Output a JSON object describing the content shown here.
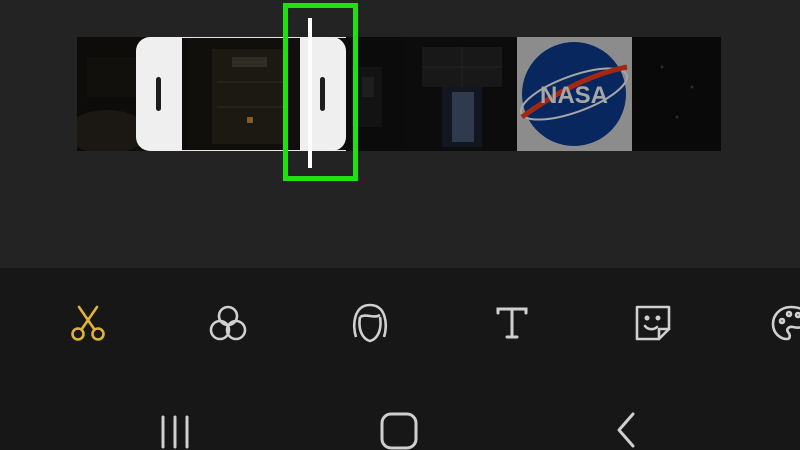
{
  "timeline": {
    "frames": [
      {
        "name": "frame-dark-room"
      },
      {
        "name": "frame-hangar-interior"
      },
      {
        "name": "frame-dark-corridor"
      },
      {
        "name": "frame-doorway-light"
      },
      {
        "name": "frame-nasa-logo",
        "logo_text": "NASA"
      },
      {
        "name": "frame-dark-end"
      }
    ]
  },
  "tools": [
    {
      "icon": "scissors-icon",
      "active": true
    },
    {
      "icon": "filter-circles-icon",
      "active": false
    },
    {
      "icon": "face-icon",
      "active": false
    },
    {
      "icon": "text-icon",
      "active": false
    },
    {
      "icon": "sticker-icon",
      "active": false
    },
    {
      "icon": "palette-icon",
      "active": false
    }
  ],
  "navbar": {
    "buttons": [
      {
        "icon": "recent-apps-icon"
      },
      {
        "icon": "home-icon"
      },
      {
        "icon": "back-icon"
      }
    ]
  },
  "colors": {
    "background": "#232323",
    "toolbar": "#171717",
    "active_tool": "#e0b23a",
    "inactive_tool": "#d0d0d0",
    "handle": "#efefef",
    "highlight": "#1fe10f"
  }
}
